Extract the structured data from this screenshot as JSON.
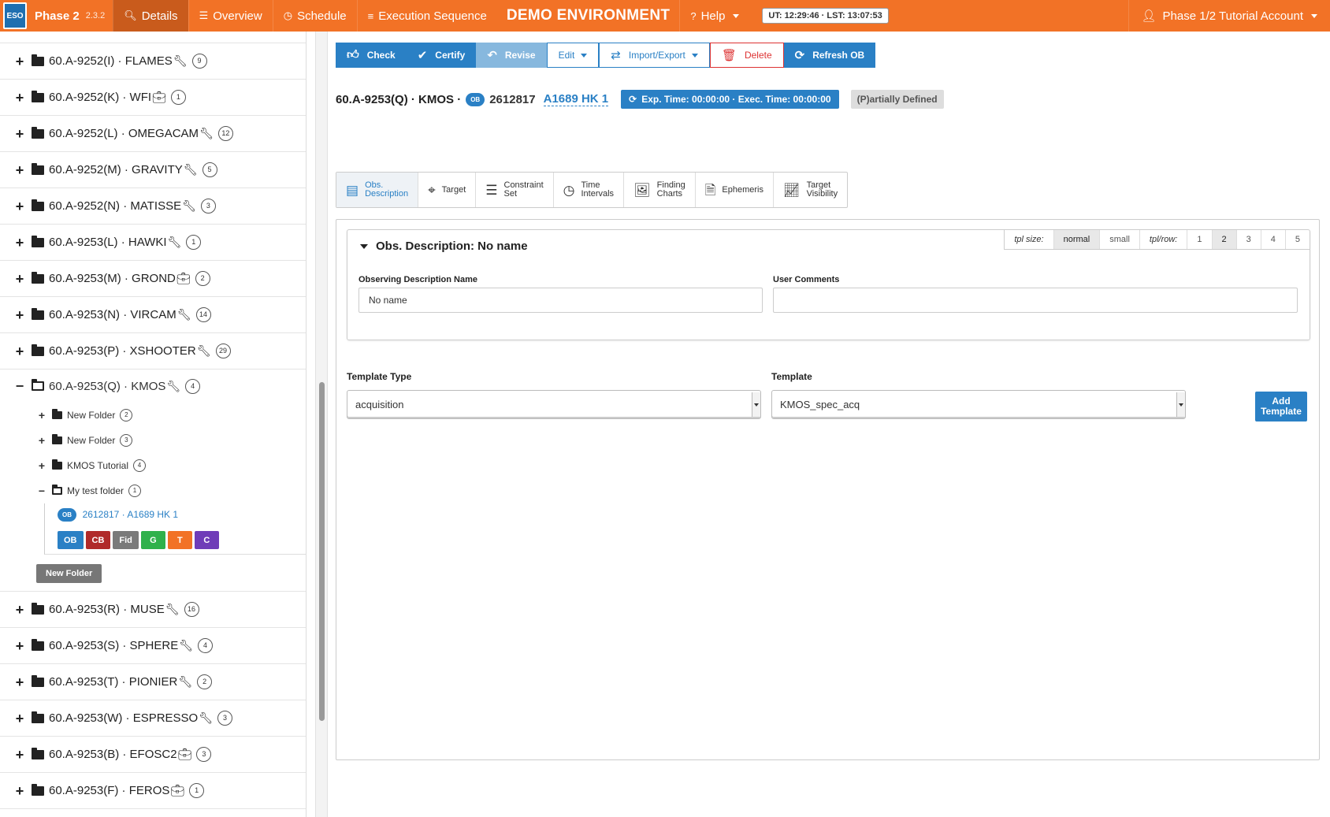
{
  "navbar": {
    "brand": "Phase 2",
    "version": "2.3.2",
    "logo": "ESO",
    "items": [
      {
        "label": "Details",
        "icon": "search-icon"
      },
      {
        "label": "Overview",
        "icon": "list-icon"
      },
      {
        "label": "Schedule",
        "icon": "clock-icon"
      },
      {
        "label": "Execution Sequence",
        "icon": "ordered-list-icon"
      }
    ],
    "environment": "DEMO ENVIRONMENT",
    "help": "Help",
    "clock": "UT: 12:29:46 · LST: 13:07:53",
    "account": "Phase 1/2 Tutorial Account"
  },
  "tree": {
    "top": [
      {
        "label": "60.A-9252(I) · FLAMES",
        "tool": "wrench",
        "count": "9"
      },
      {
        "label": "60.A-9252(K) · WFI",
        "tool": "suitcase",
        "count": "1"
      },
      {
        "label": "60.A-9252(L) · OMEGACAM",
        "tool": "wrench",
        "count": "12"
      },
      {
        "label": "60.A-9252(M) · GRAVITY",
        "tool": "wrench",
        "count": "5"
      },
      {
        "label": "60.A-9252(N) · MATISSE",
        "tool": "wrench",
        "count": "3"
      },
      {
        "label": "60.A-9253(L) · HAWKI",
        "tool": "wrench",
        "count": "1"
      },
      {
        "label": "60.A-9253(M) · GROND",
        "tool": "suitcase",
        "count": "2"
      },
      {
        "label": "60.A-9253(N) · VIRCAM",
        "tool": "wrench",
        "count": "14"
      },
      {
        "label": "60.A-9253(P) · XSHOOTER",
        "tool": "wrench",
        "count": "29"
      }
    ],
    "expanded": {
      "label": "60.A-9253(Q) · KMOS",
      "count": "4",
      "children": [
        {
          "label": "New Folder",
          "count": "2",
          "open": false
        },
        {
          "label": "New Folder",
          "count": "3",
          "open": false
        },
        {
          "label": "KMOS Tutorial",
          "count": "4",
          "open": false
        },
        {
          "label": "My test folder",
          "count": "1",
          "open": true
        }
      ],
      "ob": {
        "pill": "OB",
        "label": "2612817 · A1689 HK 1"
      },
      "ob_buttons": [
        {
          "label": "OB",
          "color": "#2a80c5"
        },
        {
          "label": "CB",
          "color": "#b02a2a"
        },
        {
          "label": "Fid",
          "color": "#7a7a7a"
        },
        {
          "label": "G",
          "color": "#2fb14b"
        },
        {
          "label": "T",
          "color": "#f27226"
        },
        {
          "label": "C",
          "color": "#6f3cb8"
        }
      ],
      "new_folder": "New Folder"
    },
    "bottom": [
      {
        "label": "60.A-9253(R) · MUSE",
        "tool": "wrench",
        "count": "16"
      },
      {
        "label": "60.A-9253(S) · SPHERE",
        "tool": "wrench",
        "count": "4"
      },
      {
        "label": "60.A-9253(T) · PIONIER",
        "tool": "wrench",
        "count": "2"
      },
      {
        "label": "60.A-9253(W) · ESPRESSO",
        "tool": "wrench",
        "count": "3"
      },
      {
        "label": "60.A-9253(B) · EFOSC2",
        "tool": "suitcase",
        "count": "3"
      },
      {
        "label": "60.A-9253(F) · FEROS",
        "tool": "suitcase",
        "count": "1"
      }
    ]
  },
  "toolbar": {
    "check": "Check",
    "certify": "Certify",
    "revise": "Revise",
    "edit": "Edit",
    "import_export": "Import/Export",
    "delete": "Delete",
    "refresh": "Refresh OB"
  },
  "ob": {
    "title": "60.A-9253(Q) · KMOS ·",
    "pill": "OB",
    "id": "2612817",
    "name": "A1689 HK 1",
    "times": "Exp. Time: 00:00:00 · Exec. Time: 00:00:00",
    "status": "(P)artially Defined"
  },
  "tabs": [
    {
      "line1": "Obs.",
      "line2": "Description",
      "icon": "obs-description-icon"
    },
    {
      "line1": "Target",
      "line2": "",
      "icon": "crosshair-icon"
    },
    {
      "line1": "Constraint",
      "line2": "Set",
      "icon": "sliders-icon"
    },
    {
      "line1": "Time",
      "line2": "Intervals",
      "icon": "clock-icon"
    },
    {
      "line1": "Finding",
      "line2": "Charts",
      "icon": "image-file-icon"
    },
    {
      "line1": "Ephemeris",
      "line2": "",
      "icon": "file-icon"
    },
    {
      "line1": "Target",
      "line2": "Visibility",
      "icon": "line-chart-icon"
    }
  ],
  "obs_description": {
    "title": "Obs. Description: No name",
    "tpl_size_label": "tpl size:",
    "tpl_sizes": [
      "normal",
      "small"
    ],
    "tpl_row_label": "tpl/row:",
    "tpl_rows": [
      "1",
      "2",
      "3",
      "4",
      "5"
    ],
    "name_label": "Observing Description Name",
    "name_value": "No name",
    "comments_label": "User Comments",
    "comments_value": ""
  },
  "templates": {
    "type_label": "Template Type",
    "type_value": "acquisition",
    "template_label": "Template",
    "template_value": "KMOS_spec_acq",
    "add_line1": "Add",
    "add_line2": "Template"
  }
}
